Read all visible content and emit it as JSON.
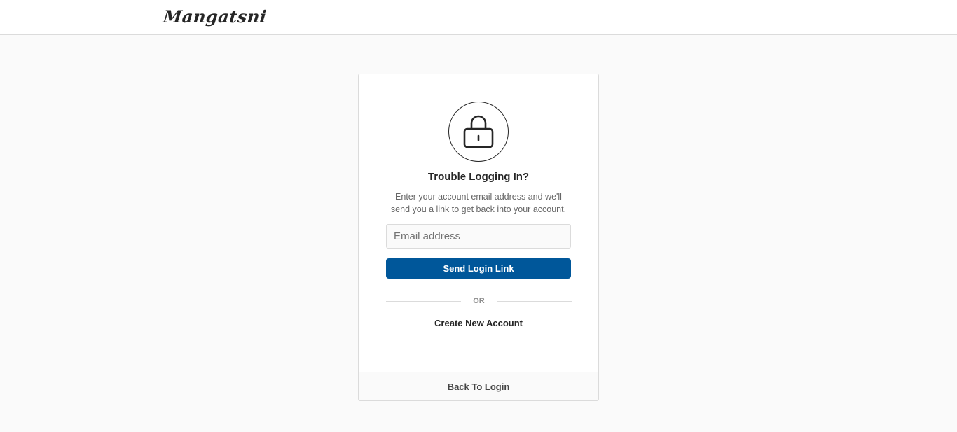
{
  "header": {
    "logo_text": "Mangatsni"
  },
  "card": {
    "icon": "lock-icon",
    "title": "Trouble Logging In?",
    "description": "Enter your account email address and we'll send you a link to get back into your account.",
    "email_field": {
      "placeholder": "Email address",
      "value": ""
    },
    "send_button_label": "Send Login Link",
    "divider_text": "OR",
    "create_account_label": "Create New Account",
    "back_to_login_label": "Back To Login"
  },
  "colors": {
    "primary_button": "#00579a",
    "background": "#fafafa",
    "border": "#dbdbdb"
  }
}
